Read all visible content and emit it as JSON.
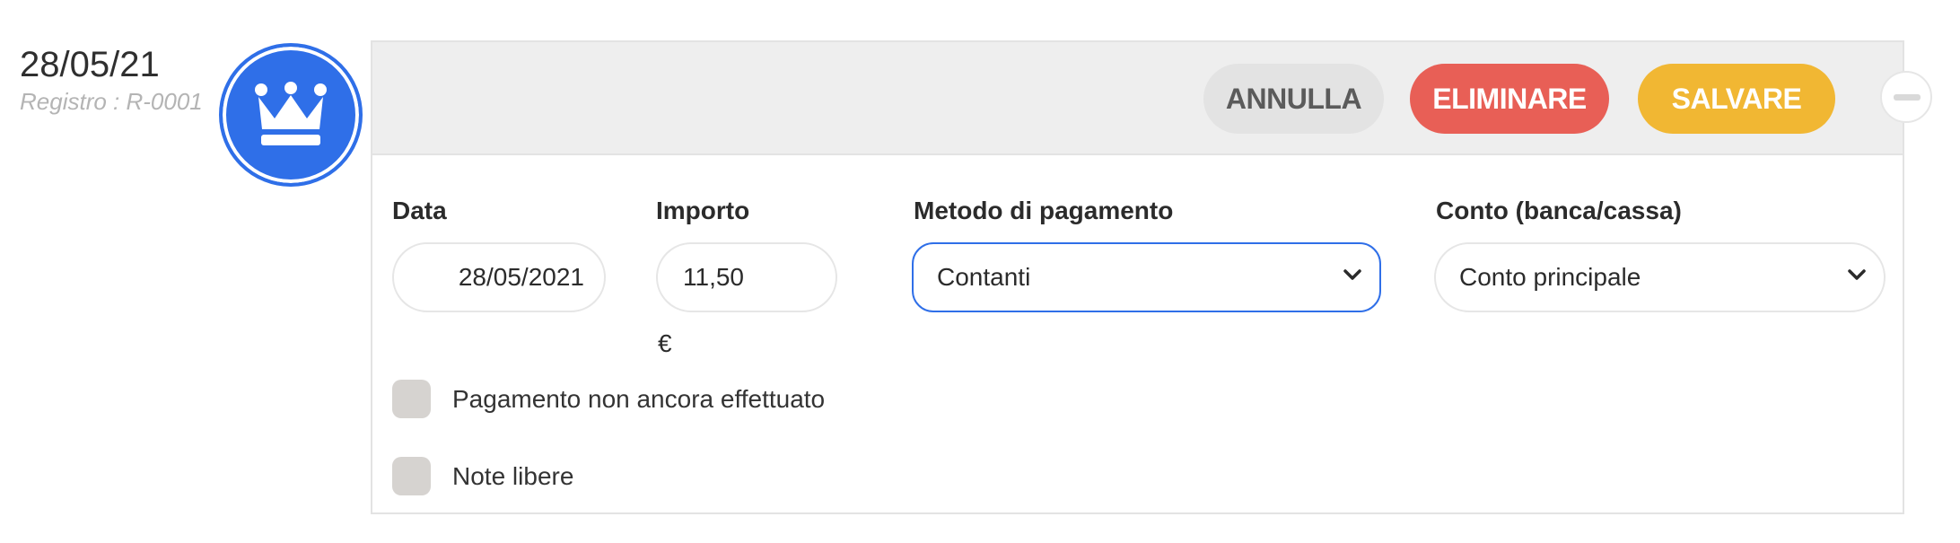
{
  "entry": {
    "date": "28/05/21",
    "registry": "Registro : R-0001",
    "avatar_icon": "crown-icon"
  },
  "header": {
    "cancel_label": "ANNULLA",
    "delete_label": "ELIMINARE",
    "save_label": "SALVARE",
    "collapse_icon": "minus-icon"
  },
  "form": {
    "date": {
      "label": "Data",
      "value": "28/05/2021"
    },
    "amount": {
      "label": "Importo",
      "value": "11,50",
      "currency": "€"
    },
    "method": {
      "label": "Metodo di pagamento",
      "value": "Contanti"
    },
    "account": {
      "label": "Conto (banca/cassa)",
      "value": "Conto principale"
    },
    "options": [
      {
        "label": "Pagamento non ancora effettuato",
        "checked": false
      },
      {
        "label": "Note libere",
        "checked": false
      }
    ]
  },
  "colors": {
    "accent_blue": "#2f6fe8",
    "delete_red": "#e85f56",
    "save_yellow": "#f1b733",
    "cancel_grey": "#e3e3e3"
  }
}
